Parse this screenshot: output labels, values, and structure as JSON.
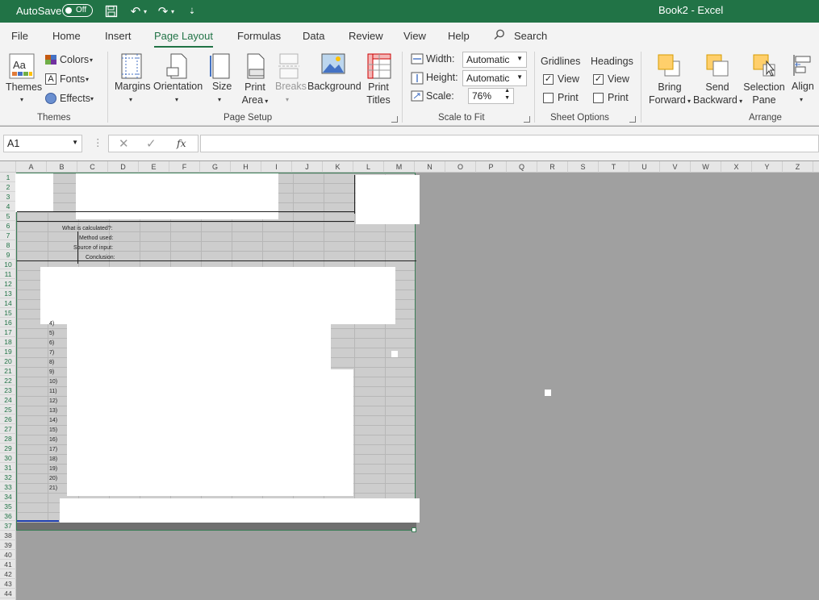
{
  "titlebar": {
    "autosave_label": "AutoSave",
    "autosave_state": "Off",
    "document_title": "Book2 - Excel"
  },
  "tabs": [
    {
      "label": "File"
    },
    {
      "label": "Home"
    },
    {
      "label": "Insert"
    },
    {
      "label": "Page Layout",
      "active": true
    },
    {
      "label": "Formulas"
    },
    {
      "label": "Data"
    },
    {
      "label": "Review"
    },
    {
      "label": "View"
    },
    {
      "label": "Help"
    }
  ],
  "search": {
    "label": "Search"
  },
  "ribbon": {
    "themes": {
      "themes_label": "Themes",
      "colors_label": "Colors",
      "fonts_label": "Fonts",
      "effects_label": "Effects",
      "group_label": "Themes"
    },
    "page_setup": {
      "margins_label": "Margins",
      "orientation_label": "Orientation",
      "size_label": "Size",
      "print_area_line1": "Print",
      "print_area_line2": "Area",
      "breaks_label": "Breaks",
      "background_label": "Background",
      "print_titles_line1": "Print",
      "print_titles_line2": "Titles",
      "group_label": "Page Setup"
    },
    "scale_to_fit": {
      "width_label": "Width:",
      "width_value": "Automatic",
      "height_label": "Height:",
      "height_value": "Automatic",
      "scale_label": "Scale:",
      "scale_value": "76%",
      "group_label": "Scale to Fit"
    },
    "sheet_options": {
      "gridlines_label": "Gridlines",
      "headings_label": "Headings",
      "gridlines_view": "View",
      "gridlines_print": "Print",
      "headings_view": "View",
      "headings_print": "Print",
      "gridlines_view_checked": true,
      "gridlines_print_checked": false,
      "headings_view_checked": true,
      "headings_print_checked": false,
      "group_label": "Sheet Options"
    },
    "arrange": {
      "bring_forward_line1": "Bring",
      "bring_forward_line2": "Forward",
      "send_backward_line1": "Send",
      "send_backward_line2": "Backward",
      "selection_pane_line1": "Selection",
      "selection_pane_line2": "Pane",
      "align_label": "Align",
      "group_label": "Arrange"
    }
  },
  "formula_bar": {
    "name_box": "A1",
    "fx_label": "fx",
    "value": ""
  },
  "columns": [
    "A",
    "B",
    "C",
    "D",
    "E",
    "F",
    "G",
    "H",
    "I",
    "J",
    "K",
    "L",
    "M",
    "N",
    "O",
    "P",
    "Q",
    "R",
    "S",
    "T",
    "U",
    "V",
    "W",
    "X",
    "Y",
    "Z"
  ],
  "rows": [
    "1",
    "2",
    "3",
    "4",
    "5",
    "6",
    "7",
    "8",
    "9",
    "10",
    "11",
    "12",
    "13",
    "14",
    "15",
    "16",
    "17",
    "18",
    "19",
    "20",
    "21",
    "22",
    "23",
    "24",
    "25",
    "26",
    "27",
    "28",
    "29",
    "30",
    "31",
    "32",
    "33",
    "34",
    "35",
    "36",
    "37",
    "38",
    "39",
    "40",
    "41",
    "42",
    "43",
    "44"
  ],
  "sheet_labels": {
    "what_label": "What is calculated?:",
    "method_label": "Method used:",
    "source_label": "Source of input:",
    "conclusion_label": "Conclusion:"
  },
  "list_numbers": [
    "4)",
    "5)",
    "6)",
    "7)",
    "8)",
    "9)",
    "10)",
    "11)",
    "12)",
    "13)",
    "14)",
    "15)",
    "16)",
    "17)",
    "18)",
    "19)",
    "20)",
    "21)"
  ],
  "colors": {
    "excel_green": "#217346",
    "canvas_gray": "#a0a0a0",
    "ribbon_bg": "#f3f3f3"
  }
}
